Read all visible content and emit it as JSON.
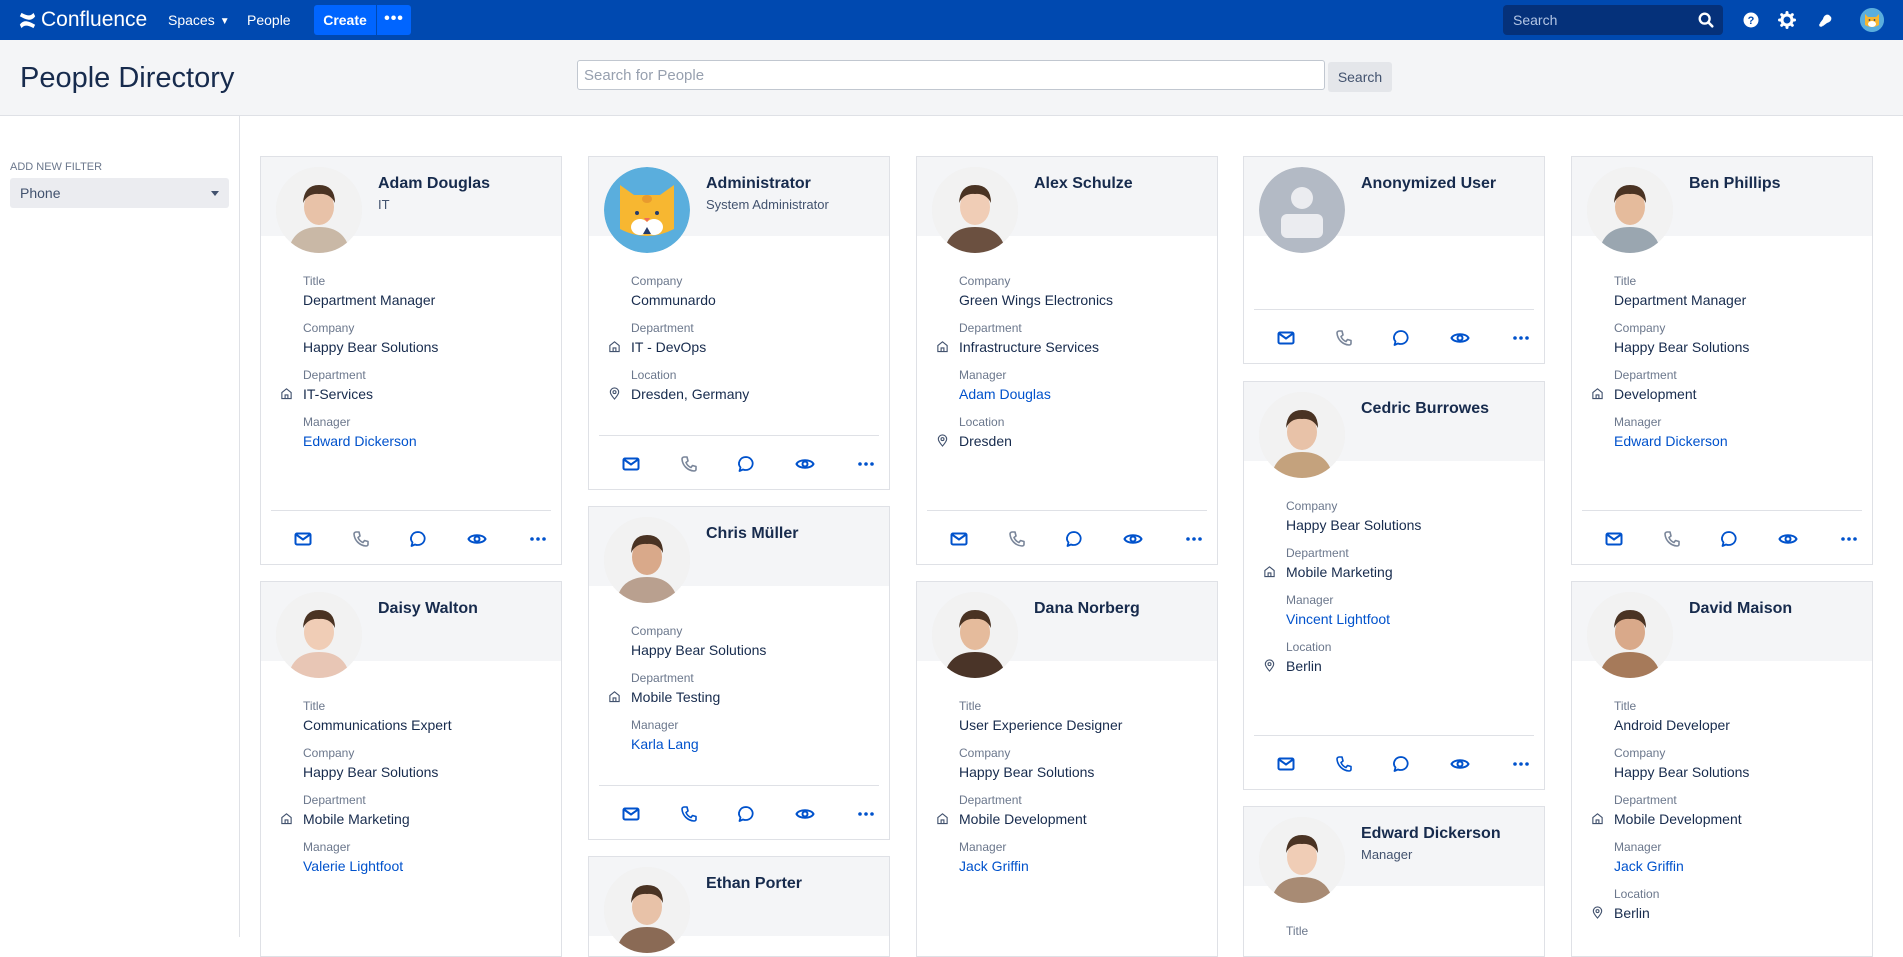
{
  "app": {
    "brand": "Confluence",
    "nav": {
      "spaces": "Spaces",
      "people": "People",
      "create": "Create",
      "more": "•••"
    },
    "search_placeholder": "Search",
    "brand_color": "#0049B0",
    "accent_color": "#0065FF",
    "link_color": "#0052CC"
  },
  "page": {
    "title": "People Directory",
    "search_placeholder": "Search for People",
    "search_button": "Search"
  },
  "sidebar": {
    "filter_label": "ADD NEW FILTER",
    "filter_selected": "Phone"
  },
  "people": [
    {
      "name": "Adam Douglas",
      "subtitle": "IT",
      "avatar": "photo",
      "fields": [
        {
          "label": "Title",
          "value": "Department Manager"
        },
        {
          "label": "Company",
          "value": "Happy Bear Solutions"
        },
        {
          "label": "Department",
          "value": "IT-Services",
          "icon": "building-icon"
        },
        {
          "label": "Manager",
          "value": "Edward Dickerson",
          "link": true
        }
      ],
      "phone_enabled": false
    },
    {
      "name": "Daisy Walton",
      "subtitle": "",
      "avatar": "photo",
      "fields": [
        {
          "label": "Title",
          "value": "Communications Expert"
        },
        {
          "label": "Company",
          "value": "Happy Bear Solutions"
        },
        {
          "label": "Department",
          "value": "Mobile Marketing",
          "icon": "building-icon"
        },
        {
          "label": "Manager",
          "value": "Valerie Lightfoot",
          "link": true
        }
      ],
      "phone_enabled": false
    },
    {
      "name": "Administrator",
      "subtitle": "System Administrator",
      "avatar": "cat",
      "fields": [
        {
          "label": "Company",
          "value": "Communardo"
        },
        {
          "label": "Department",
          "value": "IT - DevOps",
          "icon": "building-icon"
        },
        {
          "label": "Location",
          "value": "Dresden, Germany",
          "icon": "location-pin-icon"
        }
      ],
      "phone_enabled": false
    },
    {
      "name": "Chris Müller",
      "subtitle": "",
      "avatar": "photo",
      "fields": [
        {
          "label": "Company",
          "value": "Happy Bear Solutions"
        },
        {
          "label": "Department",
          "value": "Mobile Testing",
          "icon": "building-icon"
        },
        {
          "label": "Manager",
          "value": "Karla Lang",
          "link": true
        }
      ],
      "phone_enabled": true
    },
    {
      "name": "Ethan Porter",
      "subtitle": "",
      "avatar": "photo",
      "fields": [],
      "phone_enabled": false
    },
    {
      "name": "Alex Schulze",
      "subtitle": "",
      "avatar": "photo",
      "fields": [
        {
          "label": "Company",
          "value": "Green Wings Electronics"
        },
        {
          "label": "Department",
          "value": "Infrastructure Services",
          "icon": "building-icon"
        },
        {
          "label": "Manager",
          "value": "Adam Douglas",
          "link": true
        },
        {
          "label": "Location",
          "value": "Dresden",
          "icon": "location-pin-icon"
        }
      ],
      "phone_enabled": false
    },
    {
      "name": "Dana Norberg",
      "subtitle": "",
      "avatar": "photo",
      "fields": [
        {
          "label": "Title",
          "value": "User Experience Designer"
        },
        {
          "label": "Company",
          "value": "Happy Bear Solutions"
        },
        {
          "label": "Department",
          "value": "Mobile Development",
          "icon": "building-icon"
        },
        {
          "label": "Manager",
          "value": "Jack Griffin",
          "link": true
        }
      ],
      "phone_enabled": false
    },
    {
      "name": "Anonymized User",
      "subtitle": "",
      "avatar": "placeholder",
      "fields": [],
      "phone_enabled": false
    },
    {
      "name": "Cedric Burrowes",
      "subtitle": "",
      "avatar": "photo",
      "fields": [
        {
          "label": "Company",
          "value": "Happy Bear Solutions"
        },
        {
          "label": "Department",
          "value": "Mobile Marketing",
          "icon": "building-icon"
        },
        {
          "label": "Manager",
          "value": "Vincent Lightfoot",
          "link": true
        },
        {
          "label": "Location",
          "value": "Berlin",
          "icon": "location-pin-icon"
        }
      ],
      "phone_enabled": true
    },
    {
      "name": "Edward Dickerson",
      "subtitle": "Manager",
      "avatar": "photo",
      "fields": [
        {
          "label": "Title",
          "value": ""
        }
      ],
      "phone_enabled": false
    },
    {
      "name": "Ben Phillips",
      "subtitle": "",
      "avatar": "photo",
      "fields": [
        {
          "label": "Title",
          "value": "Department Manager"
        },
        {
          "label": "Company",
          "value": "Happy Bear Solutions"
        },
        {
          "label": "Department",
          "value": "Development",
          "icon": "building-icon"
        },
        {
          "label": "Manager",
          "value": "Edward Dickerson",
          "link": true
        }
      ],
      "phone_enabled": false
    },
    {
      "name": "David Maison",
      "subtitle": "",
      "avatar": "photo",
      "fields": [
        {
          "label": "Title",
          "value": "Android Developer"
        },
        {
          "label": "Company",
          "value": "Happy Bear Solutions"
        },
        {
          "label": "Department",
          "value": "Mobile Development",
          "icon": "building-icon"
        },
        {
          "label": "Manager",
          "value": "Jack Griffin",
          "link": true
        },
        {
          "label": "Location",
          "value": "Berlin",
          "icon": "location-pin-icon"
        }
      ],
      "phone_enabled": false
    }
  ],
  "card_actions": [
    "email",
    "phone",
    "chat",
    "view",
    "more"
  ]
}
